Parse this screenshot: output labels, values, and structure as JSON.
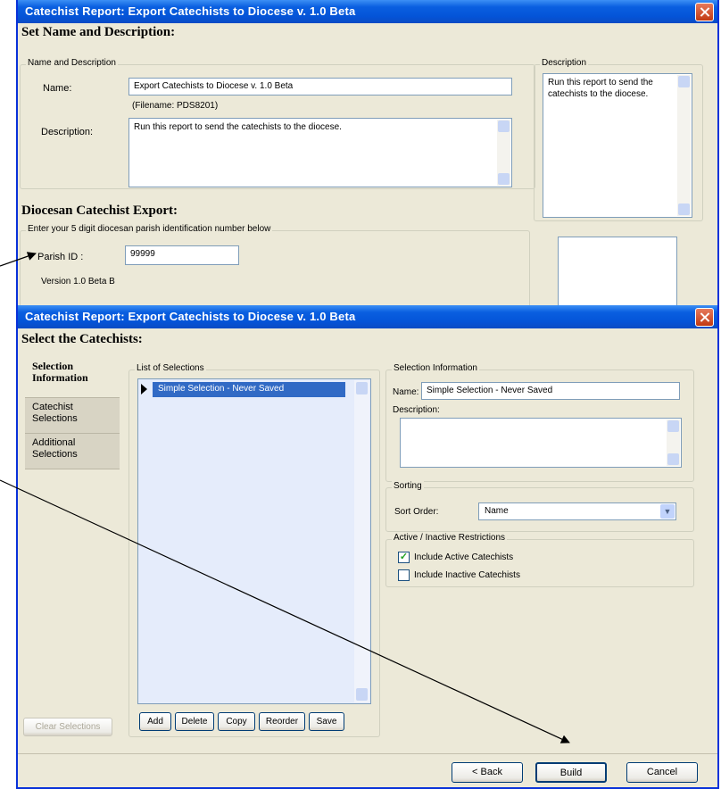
{
  "window1": {
    "title": "Catechist Report:  Export Catechists to Diocese v. 1.0 Beta",
    "section1_heading": "Set Name and Description:",
    "name_desc_group": {
      "legend": "Name and Description",
      "name_label": "Name:",
      "name_value": "Export Catechists to Diocese v. 1.0 Beta",
      "filename_text": "(Filename:  PDS8201)",
      "description_label": "Description:",
      "description_value": "Run this report to send the catechists to the diocese."
    },
    "description_panel": {
      "legend": "Description",
      "text": "Run this report to send the catechists to the diocese."
    },
    "section2_heading": "Diocesan Catechist Export:",
    "export_group": {
      "legend": "Enter your 5 digit diocesan parish identification number below",
      "parish_label": "Parish ID :",
      "parish_value": "99999",
      "version_text": "Version 1.0 Beta B"
    }
  },
  "window2": {
    "title": "Catechist Report:  Export Catechists to Diocese v. 1.0 Beta",
    "heading": "Select the Catechists:",
    "tabs": [
      {
        "label": "Selection Information",
        "active": true
      },
      {
        "label": "Catechist Selections",
        "active": false
      },
      {
        "label": "Additional Selections",
        "active": false
      }
    ],
    "clear_selections_label": "Clear Selections",
    "list_group": {
      "legend": "List of Selections",
      "items": [
        "Simple Selection - Never Saved"
      ],
      "buttons": {
        "add": "Add",
        "delete": "Delete",
        "copy": "Copy",
        "reorder": "Reorder",
        "save": "Save"
      }
    },
    "selection_info": {
      "legend": "Selection Information",
      "name_label": "Name:",
      "name_value": "Simple Selection - Never Saved",
      "description_label": "Description:"
    },
    "sorting": {
      "legend": "Sorting",
      "sort_order_label": "Sort Order:",
      "sort_order_value": "Name"
    },
    "restrictions": {
      "legend": "Active / Inactive Restrictions",
      "include_active_label": "Include Active Catechists",
      "include_active_checked": true,
      "include_inactive_label": "Include Inactive Catechists",
      "include_inactive_checked": false
    },
    "footer": {
      "back_label": "< Back",
      "build_label": "Build",
      "cancel_label": "Cancel"
    }
  }
}
